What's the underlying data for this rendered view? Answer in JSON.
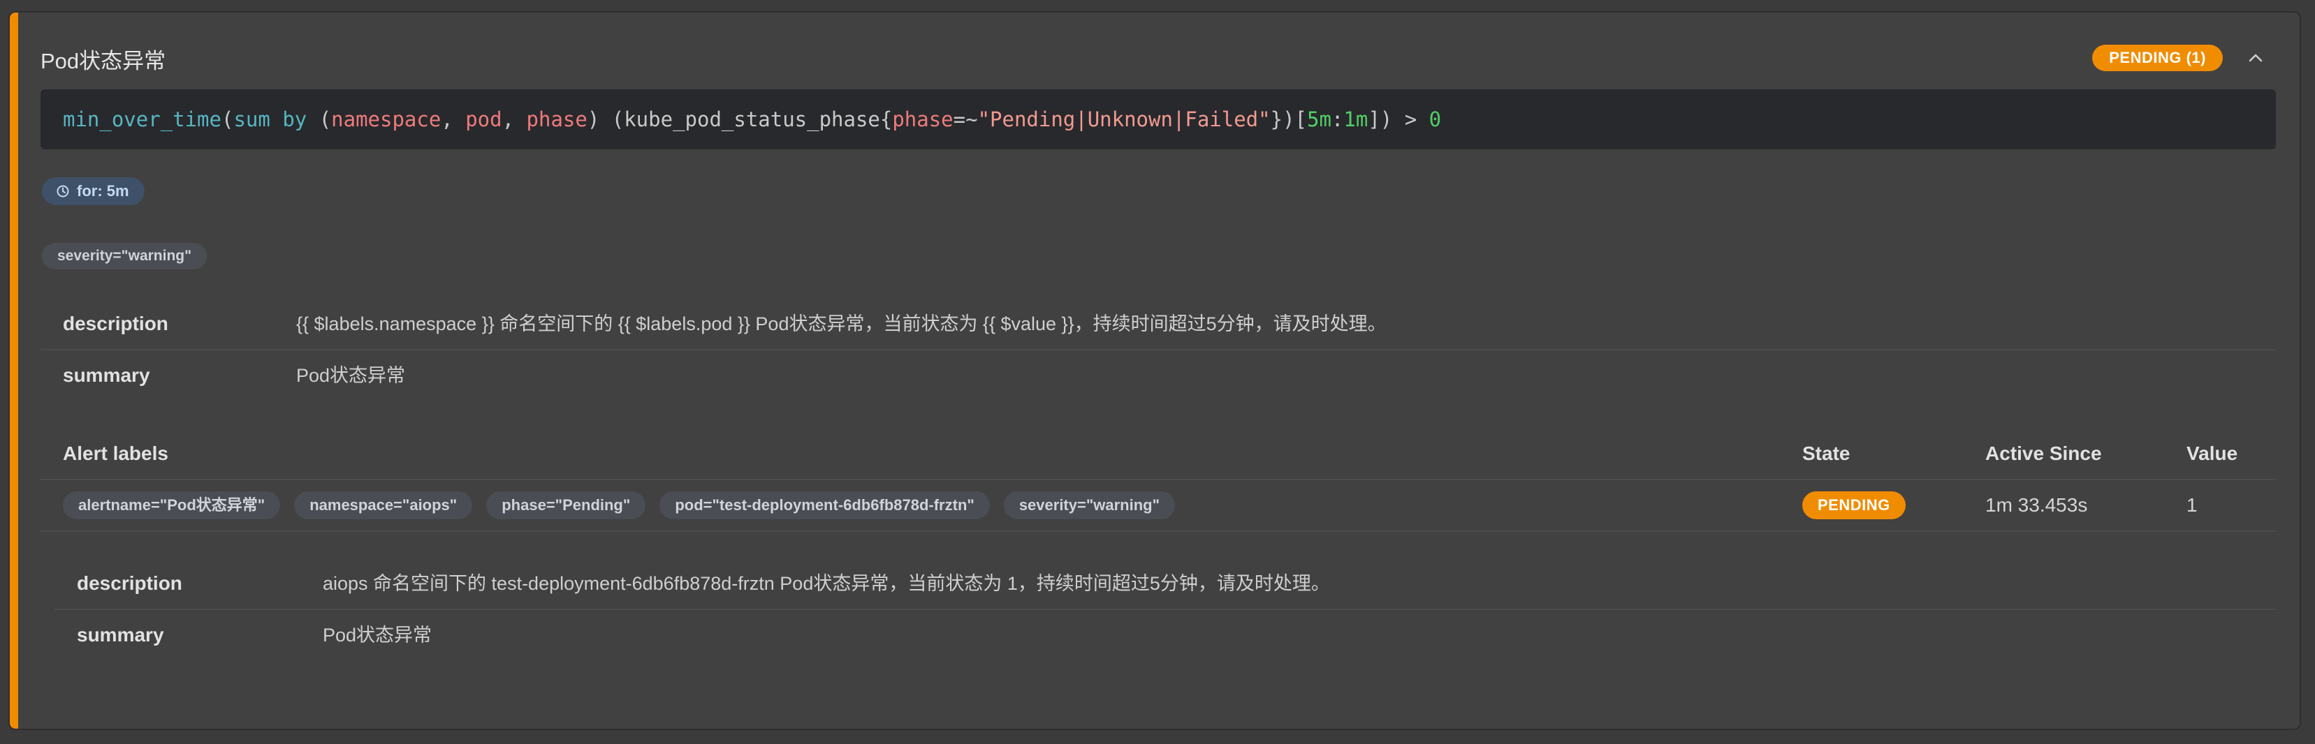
{
  "header": {
    "title": "Pod状态异常",
    "pending_badge": "PENDING (1)"
  },
  "query": {
    "fn": "min_over_time",
    "open1": "(",
    "sum_kw": "sum",
    "by_kw": "by",
    "open2": " (",
    "label_namespace": "namespace",
    "comma1": ", ",
    "label_pod": "pod",
    "comma2": ", ",
    "label_phase": "phase",
    "close_paren": ") (kube_pod_status_phase{",
    "matcher_label": "phase",
    "matcher_op": "=~",
    "matcher_value": "\"Pending|Unknown|Failed\"",
    "close_brace": "})[",
    "range": "5m",
    "colon": ":",
    "step": "1m",
    "tail": "]) > ",
    "threshold": "0"
  },
  "for_badge": "for: 5m",
  "severity_badge": "severity=\"warning\"",
  "annotations": [
    {
      "key": "description",
      "value": "{{ $labels.namespace }} 命名空间下的 {{ $labels.pod }} Pod状态异常，当前状态为 {{ $value }}，持续时间超过5分钟，请及时处理。"
    },
    {
      "key": "summary",
      "value": "Pod状态异常"
    }
  ],
  "alerts_table": {
    "columns": [
      "Alert labels",
      "State",
      "Active Since",
      "Value"
    ],
    "rows": [
      {
        "labels": [
          "alertname=\"Pod状态异常\"",
          "namespace=\"aiops\"",
          "phase=\"Pending\"",
          "pod=\"test-deployment-6db6fb878d-frztn\"",
          "severity=\"warning\""
        ],
        "state": "PENDING",
        "active_since": "1m 33.453s",
        "value": "1"
      }
    ]
  },
  "alert_annotations": [
    {
      "key": "description",
      "value": "aiops 命名空间下的 test-deployment-6db6fb878d-frztn Pod状态异常，当前状态为 1，持续时间超过5分钟，请及时处理。"
    },
    {
      "key": "summary",
      "value": "Pod状态异常"
    }
  ],
  "colors": {
    "accent": "#f08c00",
    "background": "#414141",
    "code_background": "#28292d"
  }
}
